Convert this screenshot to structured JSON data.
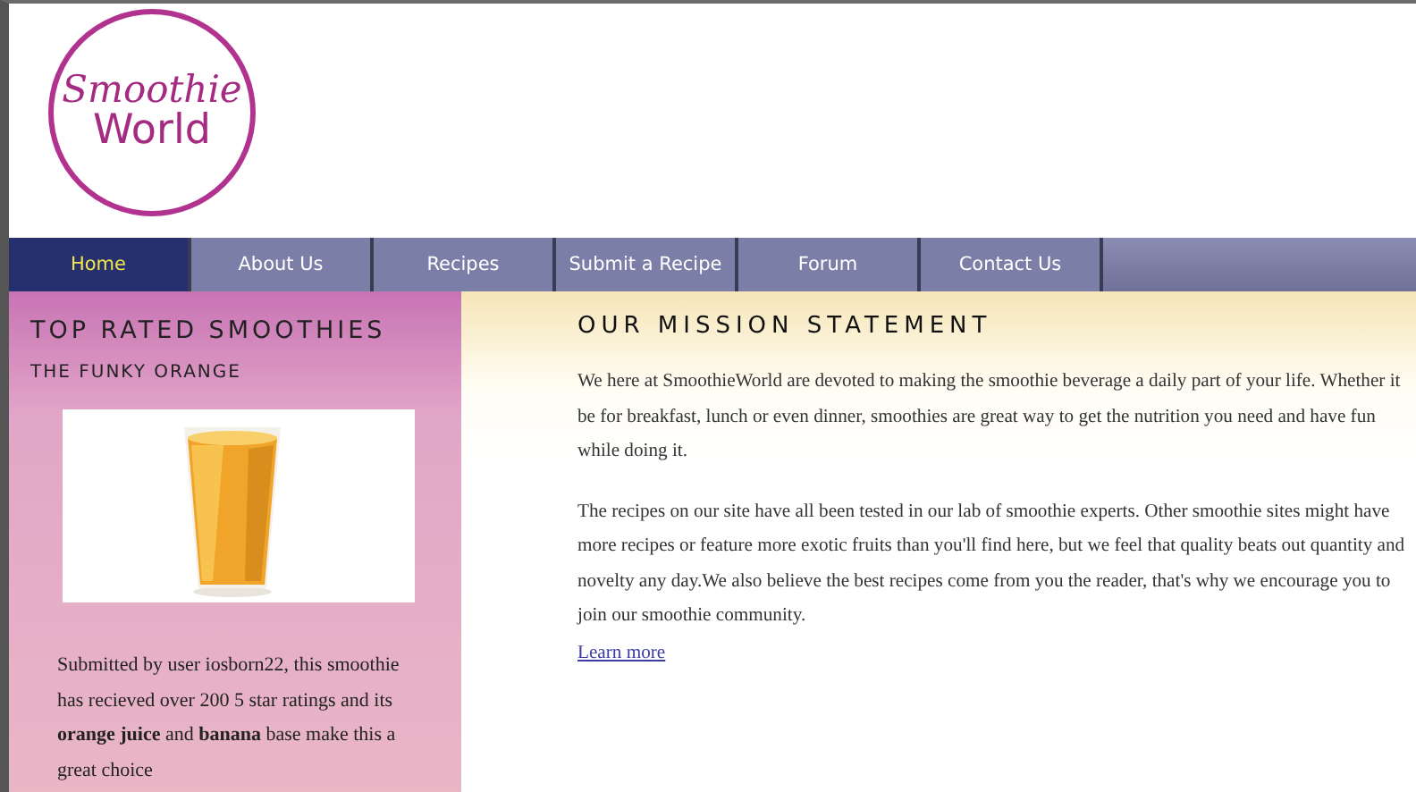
{
  "logo": {
    "line_1": "Smoothie",
    "line_2": "World"
  },
  "nav": [
    {
      "label": "Home",
      "selected": true
    },
    {
      "label": "About Us",
      "selected": false
    },
    {
      "label": "Recipes",
      "selected": false
    },
    {
      "label": "Submit a Recipe",
      "selected": false
    },
    {
      "label": "Forum",
      "selected": false
    },
    {
      "label": "Contact Us",
      "selected": false
    }
  ],
  "sidebar": {
    "title": "TOP RATED SMOOTHIES",
    "subtitle": "THE FUNKY ORANGE",
    "text": "Submitted by user iosborn22, this smoothie has recieved over 200 5 star ratings and its **orange juice** and **banana** base make this a great choice"
  },
  "main": {
    "title": "OUR MISSION STATEMENT",
    "paragraphs": [
      "We here at SmoothieWorld are devoted to making the smoothie beverage a daily part of your life. Whether it be for breakfast, lunch or even dinner, smoothies are great way to get the nutrition you need and have fun while doing it.",
      "The recipes on our site have all been tested in our lab of smoothie experts. Other smoothie sites might have more recipes or feature more exotic fruits than you'll find here, but we feel that quality beats out quantity and novelty any day.We also believe the best recipes come from you the reader, that's why we encourage you to join our smoothie community."
    ],
    "link": "Learn more"
  }
}
